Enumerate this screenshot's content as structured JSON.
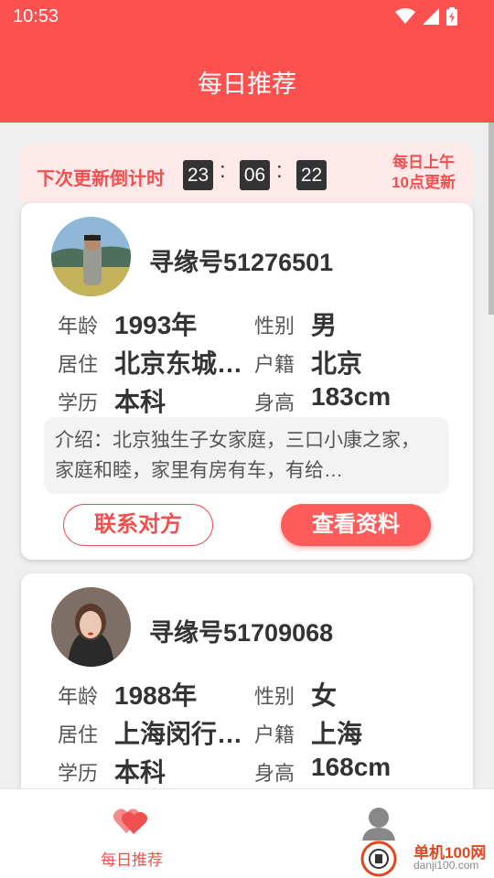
{
  "status_bar": {
    "time": "10:53"
  },
  "app_bar": {
    "title": "每日推荐"
  },
  "countdown": {
    "label": "下次更新倒计时",
    "hours": "23",
    "minutes": "06",
    "seconds": "22",
    "note_line1": "每日上午",
    "note_line2": "10点更新"
  },
  "cards": [
    {
      "id_label": "寻缘号51276501",
      "age_label": "年龄",
      "age": "1993年",
      "gender_label": "性别",
      "gender": "男",
      "residence_label": "居住",
      "residence": "北京东城…",
      "hukou_label": "户籍",
      "hukou": "北京",
      "education_label": "学历",
      "education": "本科",
      "height_label": "身高",
      "height": "183cm",
      "intro": "介绍：北京独生子女家庭，三口小康之家，家庭和睦，家里有房有车，有给…",
      "contact_button": "联系对方",
      "view_button": "查看资料"
    },
    {
      "id_label": "寻缘号51709068",
      "age_label": "年龄",
      "age": "1988年",
      "gender_label": "性别",
      "gender": "女",
      "residence_label": "居住",
      "residence": "上海闵行…",
      "hukou_label": "户籍",
      "hukou": "上海",
      "education_label": "学历",
      "education": "本科",
      "height_label": "身高",
      "height": "168cm"
    }
  ],
  "bottom_nav": {
    "tab1_label": "每日推荐"
  },
  "watermark": {
    "line1": "单机100网",
    "line2": "danji100.com"
  },
  "colors": {
    "primary": "#fd5150",
    "accent_text": "#f15050",
    "countdown_bg": "#fde9e9"
  }
}
